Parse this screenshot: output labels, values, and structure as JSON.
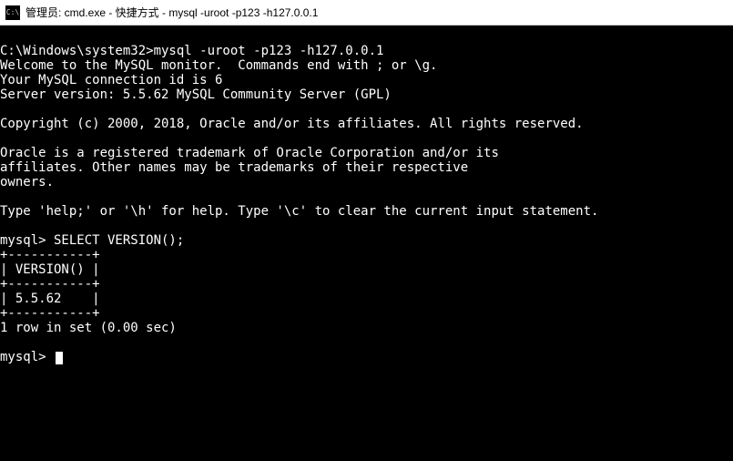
{
  "titlebar": {
    "icon_label": "C:\\",
    "text": "管理员: cmd.exe - 快捷方式 - mysql  -uroot -p123 -h127.0.0.1"
  },
  "terminal": {
    "lines": [
      "",
      "C:\\Windows\\system32>mysql -uroot -p123 -h127.0.0.1",
      "Welcome to the MySQL monitor.  Commands end with ; or \\g.",
      "Your MySQL connection id is 6",
      "Server version: 5.5.62 MySQL Community Server (GPL)",
      "",
      "Copyright (c) 2000, 2018, Oracle and/or its affiliates. All rights reserved.",
      "",
      "Oracle is a registered trademark of Oracle Corporation and/or its",
      "affiliates. Other names may be trademarks of their respective",
      "owners.",
      "",
      "Type 'help;' or '\\h' for help. Type '\\c' to clear the current input statement.",
      "",
      "mysql> SELECT VERSION();",
      "+-----------+",
      "| VERSION() |",
      "+-----------+",
      "| 5.5.62    |",
      "+-----------+",
      "1 row in set (0.00 sec)",
      "",
      "mysql> "
    ]
  },
  "chart_data": {
    "type": "table",
    "title": "SELECT VERSION()",
    "columns": [
      "VERSION()"
    ],
    "rows": [
      [
        "5.5.62"
      ]
    ],
    "footer": "1 row in set (0.00 sec)"
  }
}
